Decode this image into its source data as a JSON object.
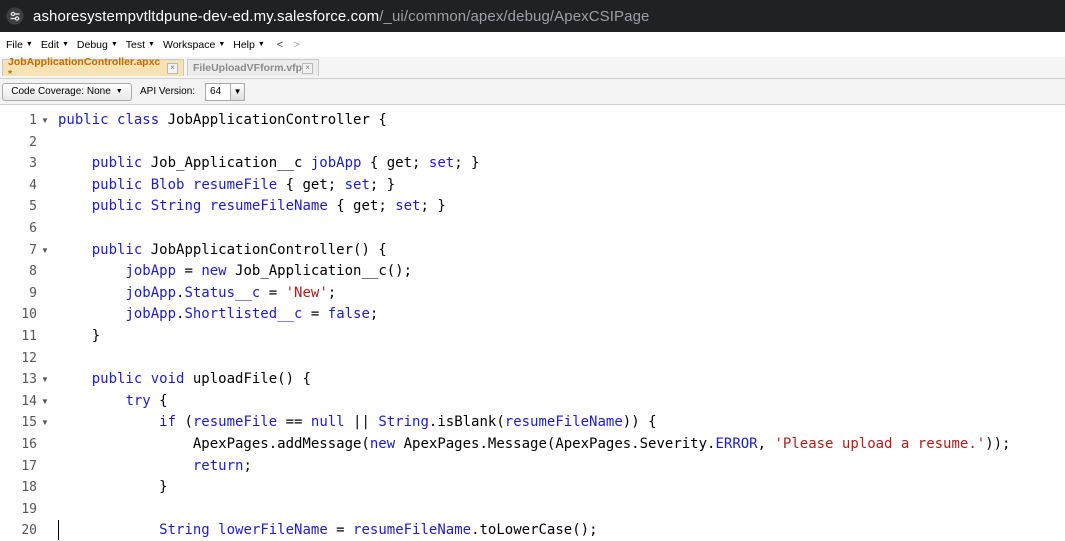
{
  "browser": {
    "url_host": "ashoresystempvtltdpune-dev-ed.my.salesforce.com",
    "url_path": "/_ui/common/apex/debug/ApexCSIPage",
    "site_icon": "tune-icon"
  },
  "menu": {
    "items": [
      {
        "label": "File",
        "name": "menu-file"
      },
      {
        "label": "Edit",
        "name": "menu-edit"
      },
      {
        "label": "Debug",
        "name": "menu-debug"
      },
      {
        "label": "Test",
        "name": "menu-test"
      },
      {
        "label": "Workspace",
        "name": "menu-workspace"
      },
      {
        "label": "Help",
        "name": "menu-help"
      }
    ],
    "back": "<",
    "forward": ">"
  },
  "tabs": [
    {
      "label": "JobApplicationController.apxc *",
      "active": true
    },
    {
      "label": "FileUploadVFform.vfp",
      "active": false
    }
  ],
  "toolbar": {
    "coverage_label": "Code Coverage: None",
    "api_label": "API Version:",
    "api_value": "64"
  },
  "colors": {
    "keyword": "#1c1cc8",
    "string": "#b31b1b",
    "active_tab_bg": "#f7e2b3",
    "active_tab_text": "#c26b00"
  },
  "code": {
    "lines": [
      {
        "n": "1",
        "fold": true,
        "html": "<span class=\"kw\">public</span> <span class=\"kw\">class</span> JobApplicationController {"
      },
      {
        "n": "2",
        "fold": false,
        "html": ""
      },
      {
        "n": "3",
        "fold": false,
        "html": "    <span class=\"kw\">public</span> Job_Application__c <span class=\"id\">jobApp</span> { get; <span class=\"kw\">set</span>; }"
      },
      {
        "n": "4",
        "fold": false,
        "html": "    <span class=\"kw\">public</span> <span class=\"kw\">Blob</span> <span class=\"id\">resumeFile</span> { get; <span class=\"kw\">set</span>; }"
      },
      {
        "n": "5",
        "fold": false,
        "html": "    <span class=\"kw\">public</span> <span class=\"kw\">String</span> <span class=\"id\">resumeFileName</span> { get; <span class=\"kw\">set</span>; }"
      },
      {
        "n": "6",
        "fold": false,
        "html": ""
      },
      {
        "n": "7",
        "fold": true,
        "html": "    <span class=\"kw\">public</span> JobApplicationController() {"
      },
      {
        "n": "8",
        "fold": false,
        "html": "        <span class=\"id\">jobApp</span> = <span class=\"kw\">new</span> Job_Application__c();"
      },
      {
        "n": "9",
        "fold": false,
        "html": "        <span class=\"id\">jobApp</span>.<span class=\"id\">Status__c</span> = <span class=\"str\">'New'</span>;"
      },
      {
        "n": "10",
        "fold": false,
        "html": "        <span class=\"id\">jobApp</span>.<span class=\"id\">Shortlisted__c</span> = <span class=\"kw\">false</span>;"
      },
      {
        "n": "11",
        "fold": false,
        "html": "    }"
      },
      {
        "n": "12",
        "fold": false,
        "html": ""
      },
      {
        "n": "13",
        "fold": true,
        "html": "    <span class=\"kw\">public</span> <span class=\"kw\">void</span> uploadFile() {"
      },
      {
        "n": "14",
        "fold": true,
        "html": "        <span class=\"kw\">try</span> {"
      },
      {
        "n": "15",
        "fold": true,
        "html": "            <span class=\"kw\">if</span> (<span class=\"id\">resumeFile</span> == <span class=\"kw\">null</span> || <span class=\"kw\">String</span>.isBlank(<span class=\"id\">resumeFileName</span>)) {"
      },
      {
        "n": "16",
        "fold": false,
        "html": "                ApexPages.addMessage(<span class=\"kw\">new</span> ApexPages.Message(ApexPages.Severity.<span class=\"id\">ERROR</span>, <span class=\"str\">'Please upload a resume.'</span>));"
      },
      {
        "n": "17",
        "fold": false,
        "html": "                <span class=\"kw\">return</span>;"
      },
      {
        "n": "18",
        "fold": false,
        "html": "            }"
      },
      {
        "n": "19",
        "fold": false,
        "html": ""
      },
      {
        "n": "20",
        "fold": false,
        "html": "            <span class=\"kw\">String</span> <span class=\"id\">lowerFileName</span> = <span class=\"id\">resumeFileName</span>.toLowerCase();"
      }
    ]
  }
}
